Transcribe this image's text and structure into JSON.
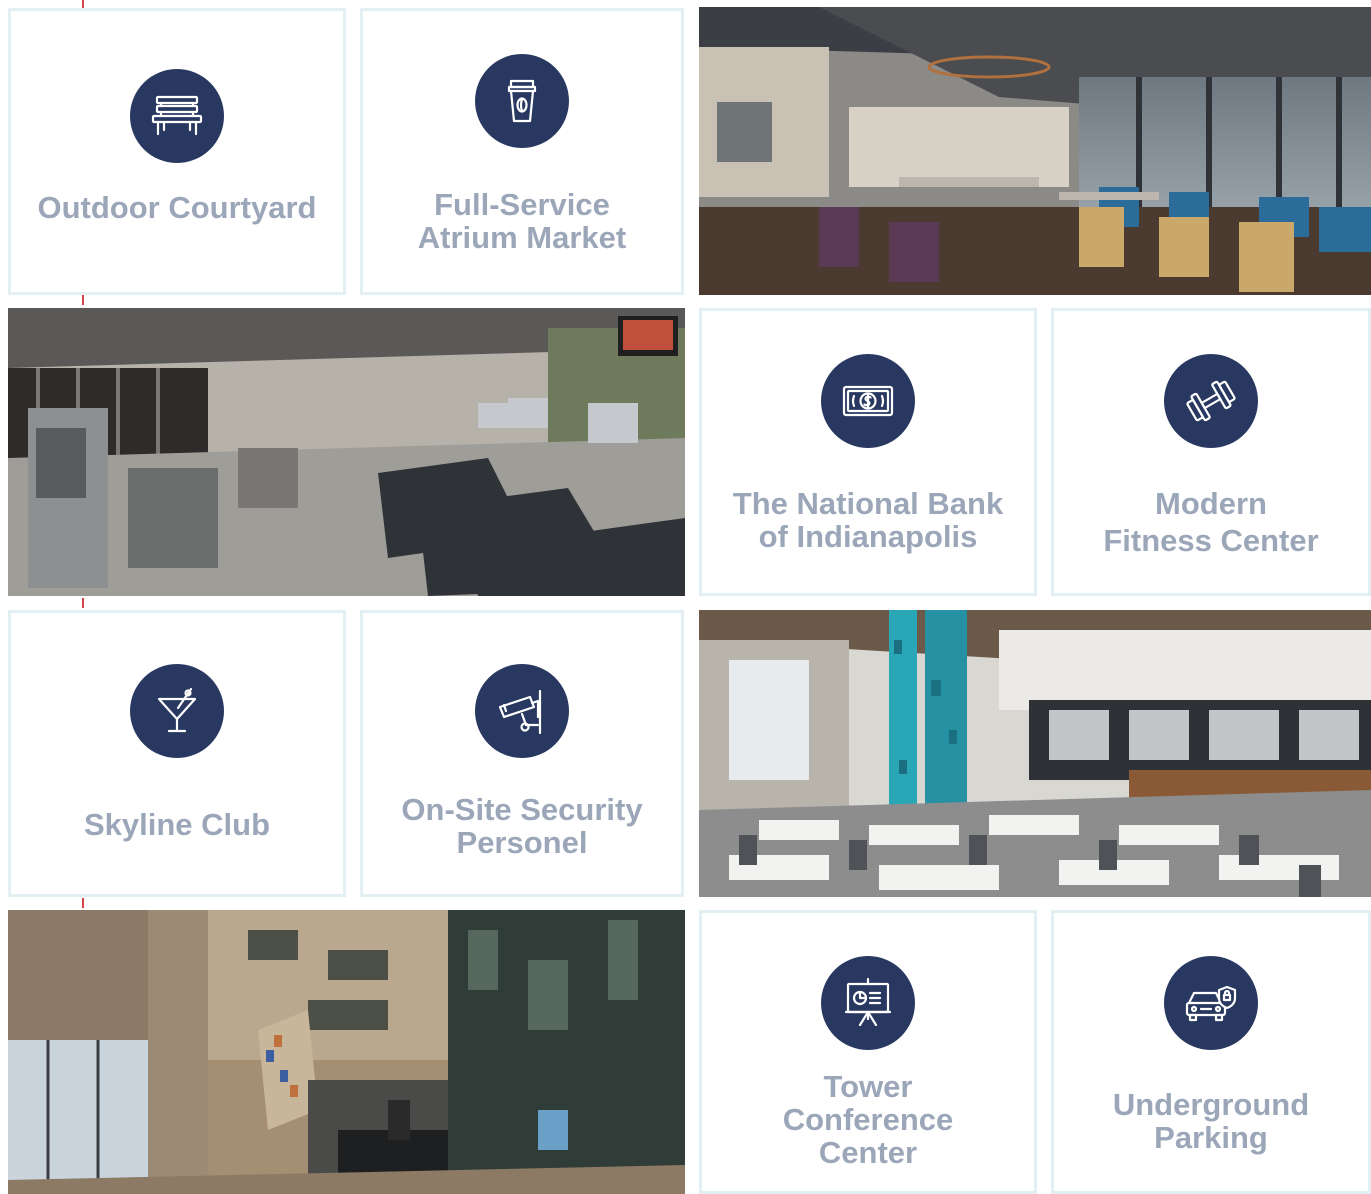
{
  "colors": {
    "icon_circle": "#283860",
    "label_text": "#9ba7b9",
    "card_border": "#e3f0f3",
    "accent_tick": "#d6434a"
  },
  "amenities": [
    {
      "label": "Outdoor Courtyard",
      "icon": "bench-icon"
    },
    {
      "label": "Full-Service\nAtrium Market",
      "icon": "coffee-cup-icon"
    },
    {
      "label": "The National Bank\nof Indianapolis",
      "icon": "banknote-icon"
    },
    {
      "label": "Modern\nFitness Center",
      "icon": "dumbbell-icon"
    },
    {
      "label": "Skyline Club",
      "icon": "martini-glass-icon"
    },
    {
      "label": "On-Site Security\nPersonel",
      "icon": "security-camera-icon"
    },
    {
      "label": "Tower\nConference\nCenter",
      "icon": "presentation-board-icon"
    },
    {
      "label": "Underground\nParking",
      "icon": "car-shield-icon"
    }
  ],
  "photos": [
    {
      "name": "cafe-dining-photo"
    },
    {
      "name": "fitness-center-photo"
    },
    {
      "name": "food-court-photo"
    },
    {
      "name": "atrium-lobby-photo"
    }
  ]
}
